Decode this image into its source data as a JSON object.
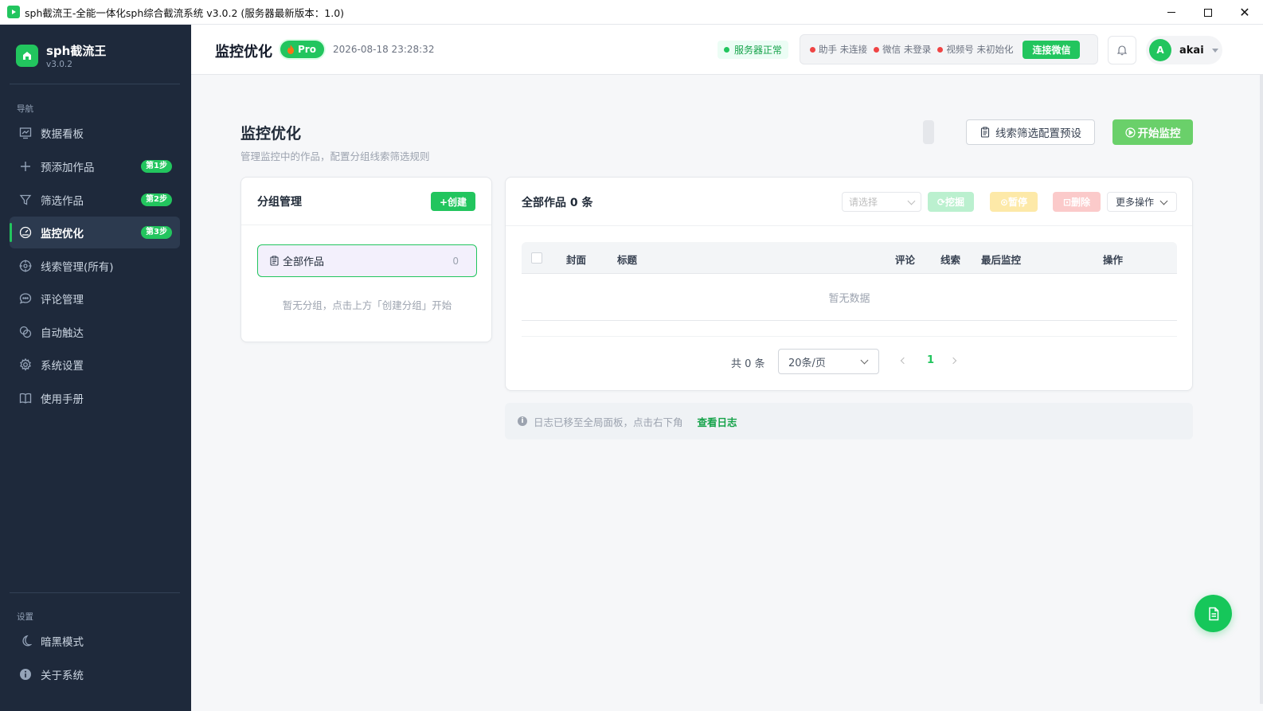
{
  "window": {
    "title": "sph截流王-全能一体化sph综合截流系统 v3.0.2 (服务器最新版本：1.0)",
    "minimize_icon": "minimize-icon",
    "maximize_icon": "maximize-icon",
    "close_icon": "close-icon"
  },
  "brand": {
    "name": "sph截流王",
    "version": "v3.0.2"
  },
  "sidebar": {
    "nav_section": "导航",
    "settings_section": "设置",
    "items": [
      {
        "label": "数据看板",
        "icon": "chart-icon",
        "badge": ""
      },
      {
        "label": "预添加作品",
        "icon": "plus-icon",
        "badge": "第1步"
      },
      {
        "label": "筛选作品",
        "icon": "filter-icon",
        "badge": "第2步"
      },
      {
        "label": "监控优化",
        "icon": "gauge-icon",
        "badge": "第3步",
        "active": true
      },
      {
        "label": "线索管理(所有)",
        "icon": "target-icon",
        "badge": ""
      },
      {
        "label": "评论管理",
        "icon": "comment-icon",
        "badge": ""
      },
      {
        "label": "自动触达",
        "icon": "link-icon",
        "badge": ""
      },
      {
        "label": "系统设置",
        "icon": "gear-icon",
        "badge": ""
      },
      {
        "label": "使用手册",
        "icon": "book-icon",
        "badge": ""
      }
    ],
    "bottom_items": [
      {
        "label": "暗黑模式",
        "icon": "moon-icon"
      },
      {
        "label": "关于系统",
        "icon": "info-icon"
      }
    ]
  },
  "header": {
    "title": "监控优化",
    "pro_label": "Pro",
    "datetime": "2026-08-18 23:28:32",
    "server_status": "服务器正常",
    "connections": [
      {
        "name": "助手",
        "status": "未连接"
      },
      {
        "name": "微信",
        "status": "未登录"
      },
      {
        "name": "视频号",
        "status": "未初始化"
      }
    ],
    "connect_button": "连接微信",
    "user": {
      "initial": "A",
      "name": "akai"
    }
  },
  "page": {
    "title": "监控优化",
    "subtitle": "管理监控中的作品，配置分组线索筛选规则",
    "preset_button": "线索筛选配置预设",
    "start_button": "开始监控"
  },
  "groups": {
    "title": "分组管理",
    "create_button": "+创建",
    "all_label": "全部作品",
    "all_count": "0",
    "empty_hint": "暂无分组，点击上方「创建分组」开始"
  },
  "works": {
    "title": "全部作品 0 条",
    "select_placeholder": "请选择",
    "dig_button": "挖掘",
    "pause_button": "暂停",
    "delete_button": "删除",
    "more_button": "更多操作",
    "columns": [
      "封面",
      "标题",
      "评论",
      "线索",
      "最后监控",
      "操作"
    ],
    "empty_text": "暂无数据",
    "pagination": {
      "total": "共 0 条",
      "page_size": "20条/页",
      "current_page": "1"
    }
  },
  "log_bar": {
    "text": "日志已移至全局面板，点击右下角",
    "link": "查看日志"
  },
  "colors": {
    "accent": "#22c55e",
    "sidebar_bg": "#1e293b",
    "start_button": "#6ad06a"
  }
}
